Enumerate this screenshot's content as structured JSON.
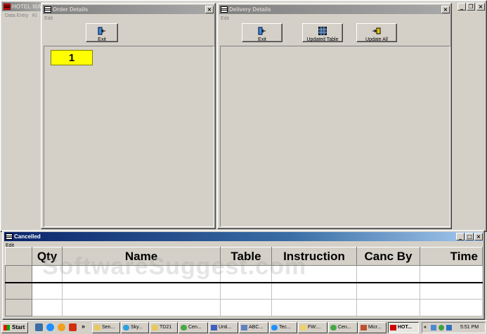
{
  "main_window": {
    "title": "HOTEL MAN",
    "menu": [
      "Data Entry",
      "Ki"
    ]
  },
  "order_details": {
    "title": "Order Details",
    "menu": "Edit",
    "exit_label": "Exit",
    "tile": "1"
  },
  "delivery_details": {
    "title": "Delivery Details",
    "menu": "Edit",
    "buttons": {
      "exit": "Exit",
      "updated_table": "Updated Table",
      "update_all": "Update All"
    }
  },
  "cancelled": {
    "title": "Cancelled",
    "menu": "Edit",
    "columns": [
      "Qty",
      "Name",
      "Table",
      "Instruction",
      "Canc By",
      "Time"
    ]
  },
  "watermark": "SoftwareSuggest.com",
  "window_controls": {
    "min": "_",
    "max": "□",
    "restore": "❐",
    "close": "×"
  },
  "taskbar": {
    "start": "Start",
    "more": "»",
    "tasks": [
      "Sen...",
      "Sky...",
      "TD21",
      "Cen...",
      "Unti...",
      "ABC...",
      "Tec...",
      "FW:...",
      "Cen...",
      "Micr...",
      "HOT..."
    ],
    "tray_arrows": "«",
    "clock": "5:51 PM"
  },
  "colors": {
    "tile": "#ffff00",
    "active_title": "#0a246a",
    "inactive_title": "#808080"
  }
}
